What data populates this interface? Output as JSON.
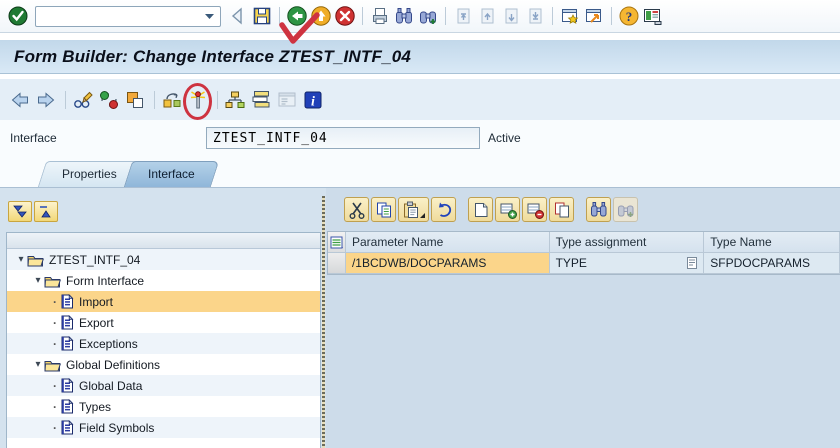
{
  "colors": {
    "selection_orange": "#FBD58A",
    "titlebar_gradient_top": "#C2D8EA",
    "titlebar_gradient_bottom": "#D9E9F6",
    "main_background": "#D4E2EE",
    "annotation_red": "#CE3340",
    "active_tab_blue": "#8FB6D9",
    "toolbar_button_tan": "#EFDB9B"
  },
  "top_toolbar": {
    "command_field": {
      "value": "",
      "placeholder": ""
    },
    "icons": [
      "enter-icon",
      "dropdown-icon",
      "back-triangle-icon",
      "save-icon",
      "back-icon",
      "exit-icon",
      "cancel-icon",
      "print-icon",
      "find-icon",
      "find-next-icon",
      "first-page-icon",
      "previous-page-icon",
      "next-page-icon",
      "last-page-icon",
      "new-session-icon",
      "create-shortcut-icon",
      "help-icon",
      "customize-layout-icon"
    ]
  },
  "title_bar": {
    "title": "Form Builder: Change Interface ZTEST_INTF_04"
  },
  "app_toolbar": {
    "icons": [
      "back-arrow-icon",
      "forward-arrow-icon",
      "display-change-icon",
      "check-toggle-icon",
      "copy-icon",
      "transfer-icon",
      "activate-icon",
      "hierarchy-icon",
      "table-view-icon",
      "form-view-icon",
      "info-icon"
    ]
  },
  "header_area": {
    "interface_label": "Interface",
    "interface_value": "ZTEST_INTF_04",
    "status": "Active"
  },
  "tab_strip": {
    "tabs": [
      {
        "label": "Properties",
        "active": false
      },
      {
        "label": "Interface",
        "active": true
      }
    ]
  },
  "tree_panel": {
    "toolbar_icons": [
      "expand-all-icon",
      "collapse-all-icon"
    ],
    "items": [
      {
        "label": "ZTEST_INTF_04",
        "type": "folder",
        "indent": 0,
        "expanded": true,
        "selected": false
      },
      {
        "label": "Form Interface",
        "type": "folder",
        "indent": 1,
        "expanded": true,
        "selected": false
      },
      {
        "label": "Import",
        "type": "doc",
        "indent": 2,
        "selected": true
      },
      {
        "label": "Export",
        "type": "doc",
        "indent": 2,
        "selected": false
      },
      {
        "label": "Exceptions",
        "type": "doc",
        "indent": 2,
        "selected": false
      },
      {
        "label": "Global Definitions",
        "type": "folder",
        "indent": 1,
        "expanded": true,
        "selected": false
      },
      {
        "label": "Global Data",
        "type": "doc",
        "indent": 2,
        "selected": false
      },
      {
        "label": "Types",
        "type": "doc",
        "indent": 2,
        "selected": false
      },
      {
        "label": "Field Symbols",
        "type": "doc",
        "indent": 2,
        "selected": false
      }
    ]
  },
  "parameter_table": {
    "toolbar_icons": [
      "cut-icon",
      "copy-icon",
      "paste-icon",
      "undo-icon",
      "new-row-icon",
      "insert-row-icon",
      "delete-row-icon",
      "duplicate-row-icon",
      "find-icon",
      "find-next-icon"
    ],
    "columns": [
      "Parameter Name",
      "Type assignment",
      "Type Name"
    ],
    "rows": [
      {
        "parameter_name": "/1BCDWB/DOCPARAMS",
        "type_assignment": "TYPE",
        "type_name": "SFPDOCPARAMS",
        "selected": true
      }
    ]
  },
  "annotations": [
    {
      "type": "checkmark",
      "target": "back-icon",
      "color": "#CE3340"
    },
    {
      "type": "ellipse",
      "target": "activate-icon",
      "color": "#CE3340"
    }
  ]
}
